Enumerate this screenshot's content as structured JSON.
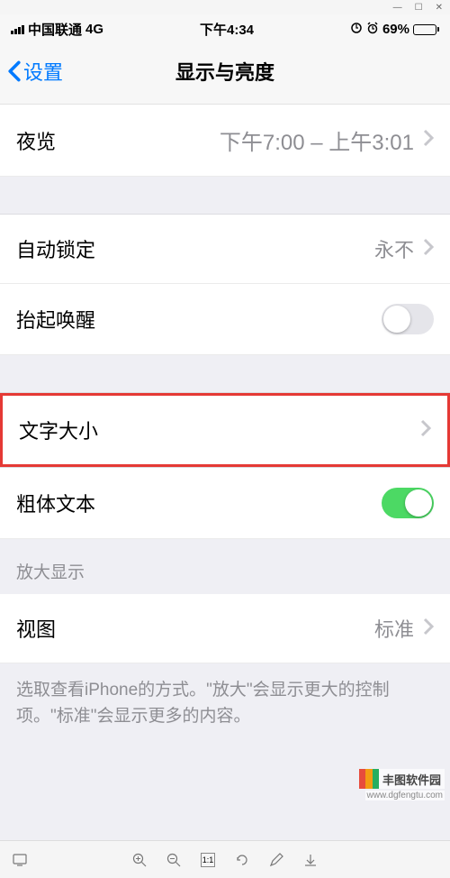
{
  "window_chrome": {
    "minimize": "—",
    "maximize": "☐",
    "close": "✕"
  },
  "status_bar": {
    "carrier": "中国联通",
    "network": "4G",
    "time": "下午4:34",
    "rotation_icon": "⟳",
    "alarm_icon": "⏰",
    "battery_pct": "69%",
    "battery_fill_pct": 69
  },
  "nav": {
    "back_label": "设置",
    "title": "显示与亮度"
  },
  "rows": {
    "night_shift": {
      "label": "夜览",
      "value": "下午7:00 – 上午3:01"
    },
    "auto_lock": {
      "label": "自动锁定",
      "value": "永不"
    },
    "raise_to_wake": {
      "label": "抬起唤醒",
      "on": false
    },
    "text_size": {
      "label": "文字大小"
    },
    "bold_text": {
      "label": "粗体文本",
      "on": true
    },
    "view": {
      "label": "视图",
      "value": "标准"
    }
  },
  "sections": {
    "zoom_header": "放大显示",
    "zoom_footer": "选取查看iPhone的方式。\"放大\"会显示更大的控制项。\"标准\"会显示更多的内容。"
  },
  "toolbar": {
    "scale_number": "1:1"
  },
  "watermark": {
    "brand": "丰图软件园",
    "url": "www.dgfengtu.com"
  }
}
